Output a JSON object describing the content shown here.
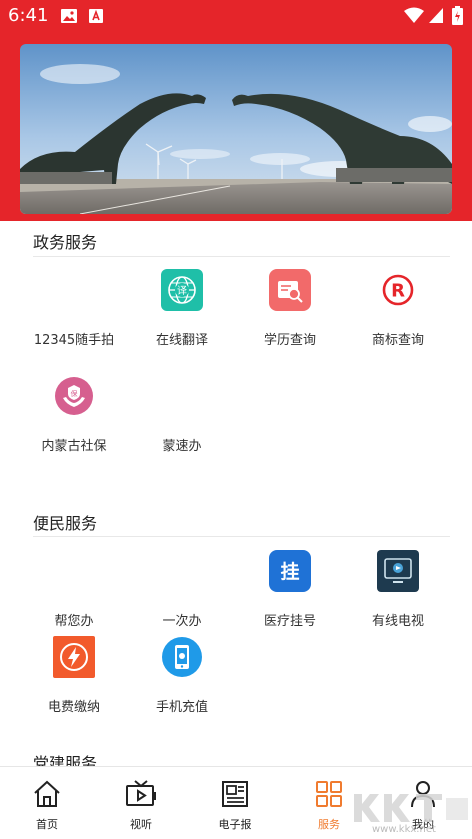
{
  "status_bar": {
    "time": "6:41"
  },
  "sections": [
    {
      "title": "政务服务",
      "items": [
        {
          "label": "12345随手拍",
          "icon": "none"
        },
        {
          "label": "在线翻译",
          "icon": "translate-globe-icon"
        },
        {
          "label": "学历查询",
          "icon": "certificate-search-icon"
        },
        {
          "label": "商标查询",
          "icon": "registered-trademark-icon"
        },
        {
          "label": "内蒙古社保",
          "icon": "social-security-hand-icon"
        },
        {
          "label": "蒙速办",
          "icon": "none"
        }
      ]
    },
    {
      "title": "便民服务",
      "items": [
        {
          "label": "帮您办",
          "icon": "none"
        },
        {
          "label": "一次办",
          "icon": "none"
        },
        {
          "label": "医疗挂号",
          "icon": "medical-registration-icon"
        },
        {
          "label": "有线电视",
          "icon": "cable-tv-icon"
        },
        {
          "label": "电费缴纳",
          "icon": "electricity-bolt-icon"
        },
        {
          "label": "手机充值",
          "icon": "phone-recharge-icon"
        }
      ]
    },
    {
      "title": "党建服务",
      "items": []
    }
  ],
  "tabbar": {
    "tabs": [
      {
        "label": "首页",
        "icon": "home-icon"
      },
      {
        "label": "视听",
        "icon": "tv-play-icon"
      },
      {
        "label": "电子报",
        "icon": "newspaper-icon"
      },
      {
        "label": "服务",
        "icon": "grid-services-icon",
        "active": true
      },
      {
        "label": "我的",
        "icon": "person-icon"
      }
    ]
  },
  "colors": {
    "brand_red": "#e5252a",
    "active_tab": "#f07b2f"
  },
  "watermark": {
    "text": "www.kkx.net"
  }
}
